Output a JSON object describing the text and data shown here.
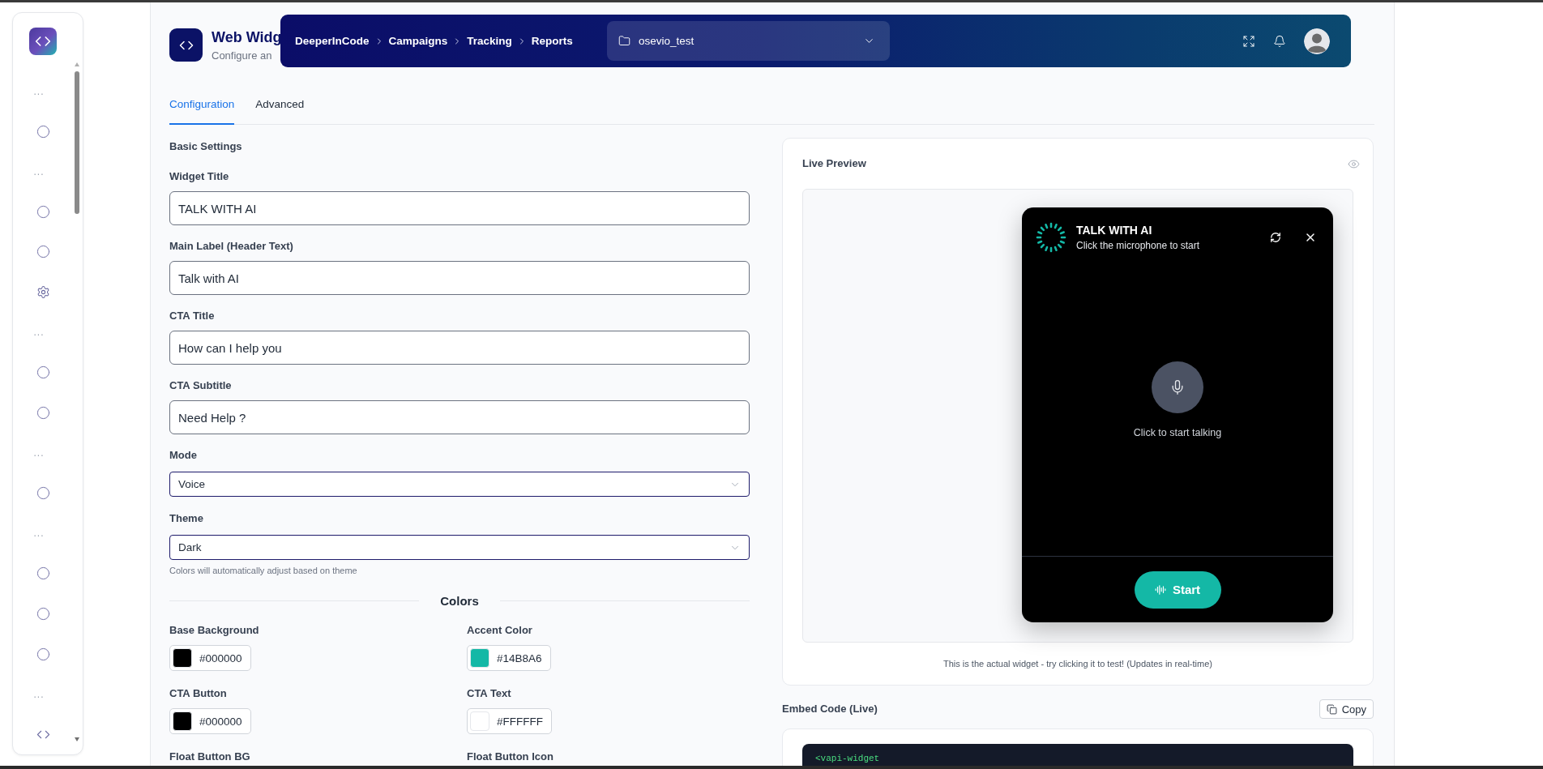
{
  "sidebar": {
    "items": [
      {
        "kind": "section",
        "label": "..."
      },
      {
        "kind": "link"
      },
      {
        "kind": "section",
        "label": "..."
      },
      {
        "kind": "link"
      },
      {
        "kind": "link"
      },
      {
        "kind": "settings"
      },
      {
        "kind": "section",
        "label": "..."
      },
      {
        "kind": "link"
      },
      {
        "kind": "link"
      },
      {
        "kind": "section",
        "label": "..."
      },
      {
        "kind": "link"
      },
      {
        "kind": "section",
        "label": "..."
      },
      {
        "kind": "link"
      },
      {
        "kind": "link"
      },
      {
        "kind": "link"
      },
      {
        "kind": "section",
        "label": "..."
      },
      {
        "kind": "embed"
      }
    ]
  },
  "page": {
    "title": "Web Widg",
    "subtitle": "Configure an"
  },
  "header": {
    "breadcrumb": [
      "DeeperInCode",
      "Campaigns",
      "Tracking",
      "Reports"
    ],
    "project": {
      "value": "osevio_test"
    }
  },
  "tabs": [
    {
      "label": "Configuration",
      "selected": true
    },
    {
      "label": "Advanced",
      "selected": false
    }
  ],
  "basic_settings": {
    "heading": "Basic Settings",
    "fields": [
      {
        "kind": "text",
        "label": "Widget Title",
        "value": "TALK WITH AI"
      },
      {
        "kind": "text",
        "label": "Main Label (Header Text)",
        "value": "Talk with AI"
      },
      {
        "kind": "text",
        "label": "CTA Title",
        "value": "How can I help you"
      },
      {
        "kind": "text",
        "label": "CTA Subtitle",
        "value": "Need Help ?"
      },
      {
        "kind": "select",
        "label": "Mode",
        "value": "Voice"
      },
      {
        "kind": "select",
        "label": "Theme",
        "value": "Dark",
        "hint": "Colors will automatically adjust based on theme"
      }
    ]
  },
  "colors": {
    "heading": "Colors",
    "items": [
      {
        "label": "Base Background",
        "value": "#000000",
        "color": "#000000"
      },
      {
        "label": "Accent Color",
        "value": "#14B8A6",
        "color": "#14b8a6"
      },
      {
        "label": "CTA Button",
        "value": "#000000",
        "color": "#000000"
      },
      {
        "label": "CTA Text",
        "value": "#FFFFFF",
        "color": "#ffffff"
      },
      {
        "label": "Float Button BG"
      },
      {
        "label": "Float Button Icon"
      }
    ]
  },
  "preview": {
    "heading": "Live Preview",
    "widget": {
      "title": "TALK WITH AI",
      "subtitle": "Click the microphone to start",
      "prompt": "Click to start talking",
      "button": "Start"
    },
    "caption": "This is the actual widget - try clicking it to test! (Updates in real-time)"
  },
  "embed": {
    "heading": "Embed Code (Live)",
    "copy_button": "Copy",
    "code": "<vapi-widget"
  }
}
